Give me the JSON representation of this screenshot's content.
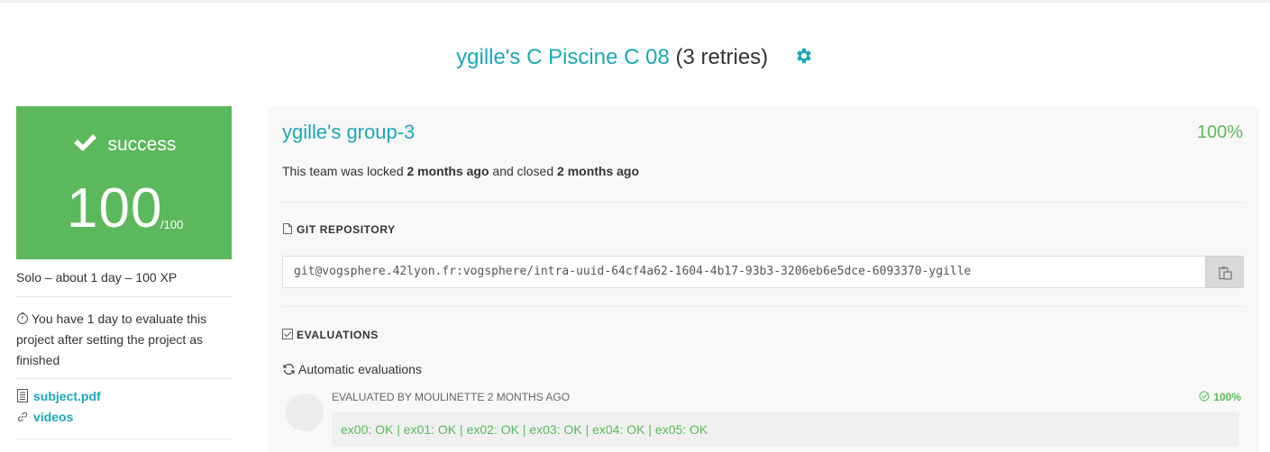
{
  "title": {
    "project_link": "ygille's C Piscine C 08",
    "retries": "(3 retries)"
  },
  "score_card": {
    "status": "success",
    "score": "100",
    "score_max": "/100",
    "color": "#5cb85c"
  },
  "sidebar": {
    "meta": "Solo – about 1 day – 100 XP",
    "evaluation_notice": "You have 1 day to evaluate this project after setting the project as finished",
    "links": [
      {
        "label": "subject.pdf",
        "icon": "document-icon"
      },
      {
        "label": "videos",
        "icon": "link-icon"
      }
    ]
  },
  "team": {
    "name": "ygille's group-3",
    "percentage": "100%",
    "lock_prefix": "This team was locked ",
    "locked_ago": "2 months ago",
    "lock_middle": " and closed ",
    "closed_ago": "2 months ago"
  },
  "git": {
    "label": "GIT REPOSITORY",
    "url": "git@vogsphere.42lyon.fr:vogsphere/intra-uuid-64cf4a62-1604-4b17-93b3-3206eb6e5dce-6093370-ygille"
  },
  "evaluations": {
    "label": "EVALUATIONS",
    "automatic_label": "Automatic evaluations",
    "items": [
      {
        "evaluated_by": "EVALUATED BY MOULINETTE 2 MONTHS AGO",
        "percentage": "100%",
        "result": "ex00: OK | ex01: OK | ex02: OK | ex03: OK | ex04: OK | ex05: OK"
      }
    ]
  },
  "colors": {
    "accent": "#1aa8b8",
    "success": "#5cb85c"
  }
}
